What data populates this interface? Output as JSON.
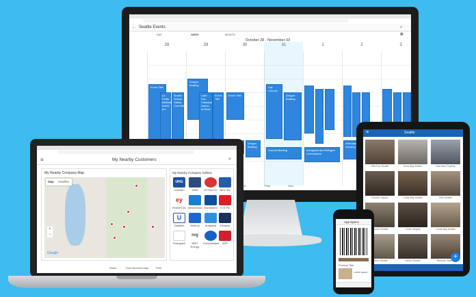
{
  "monitor": {
    "app_title": "Seattle Events",
    "range": "October 28 - November 03",
    "view_tabs": [
      "DAY",
      "WEEK",
      "MONTH"
    ],
    "days": [
      "28",
      "29",
      "30",
      "31",
      "1",
      "2",
      "3"
    ],
    "events": [
      "Event Title",
      "La Petite Birthday Inside the",
      "Seattle School Safety Committee",
      "Dragon Boating",
      "Latin Fan Classical Dance at Rizal",
      "Event Title",
      "Event Title",
      "Fall Council",
      "Dragon Boating",
      "Latin Cooking Classes at Fire Kitchen",
      "Event Title",
      "Dragon Boating",
      "Council Briefing",
      "Immigrant and Refugee Commission",
      "Affordable Housing"
    ],
    "bottom_nav": [
      "Share",
      "Print",
      "Grid"
    ]
  },
  "laptop": {
    "title": "My Nearby Customers",
    "map_card_title": "My Nearby Company Map",
    "map_tabs": [
      "Map",
      "Satellite"
    ],
    "gallery_title": "My Nearby Company Gallery",
    "companies": [
      "LinkedIn",
      "UBM",
      "PI Pico Inc",
      "New Tec",
      "Pentem Inc",
      "Zimmerman",
      "Enrollment",
      "TCS Pro",
      "Datalink",
      "VertiCyl",
      "Analytica",
      "Fenwick",
      "PrincipalS",
      "NRG Energy",
      "Consolidated",
      "ADP"
    ],
    "logos": [
      "UHG",
      "",
      "",
      "",
      "ey",
      "",
      "",
      "",
      "U",
      "",
      "",
      "",
      "",
      "nrg",
      "",
      ""
    ],
    "google": "Google",
    "bottom_nav": [
      "Share",
      "Find Services Map",
      "Print"
    ]
  },
  "tablet": {
    "title": "Seattle",
    "tiles": [
      "Pike Pac Seattle",
      "Drive Bay Seattle",
      "Sherman Property",
      "Pioneer Square",
      "Cedar Bay Seattle",
      "Pike Seattle",
      "Harvard Seattle",
      "Cedar Heights",
      "Cedar Bay Seattle",
      "Queen Seattle",
      "Harbor Seattle",
      "Belltown Seattle"
    ],
    "fab": "+"
  },
  "phone": {
    "title": "App Specs",
    "caption": "Product Title",
    "line": "Lorem Ipsum"
  },
  "colors": {
    "background": "#3dbcf0",
    "event_blue": "#2e86de",
    "app_bar": "#1b63b5"
  }
}
